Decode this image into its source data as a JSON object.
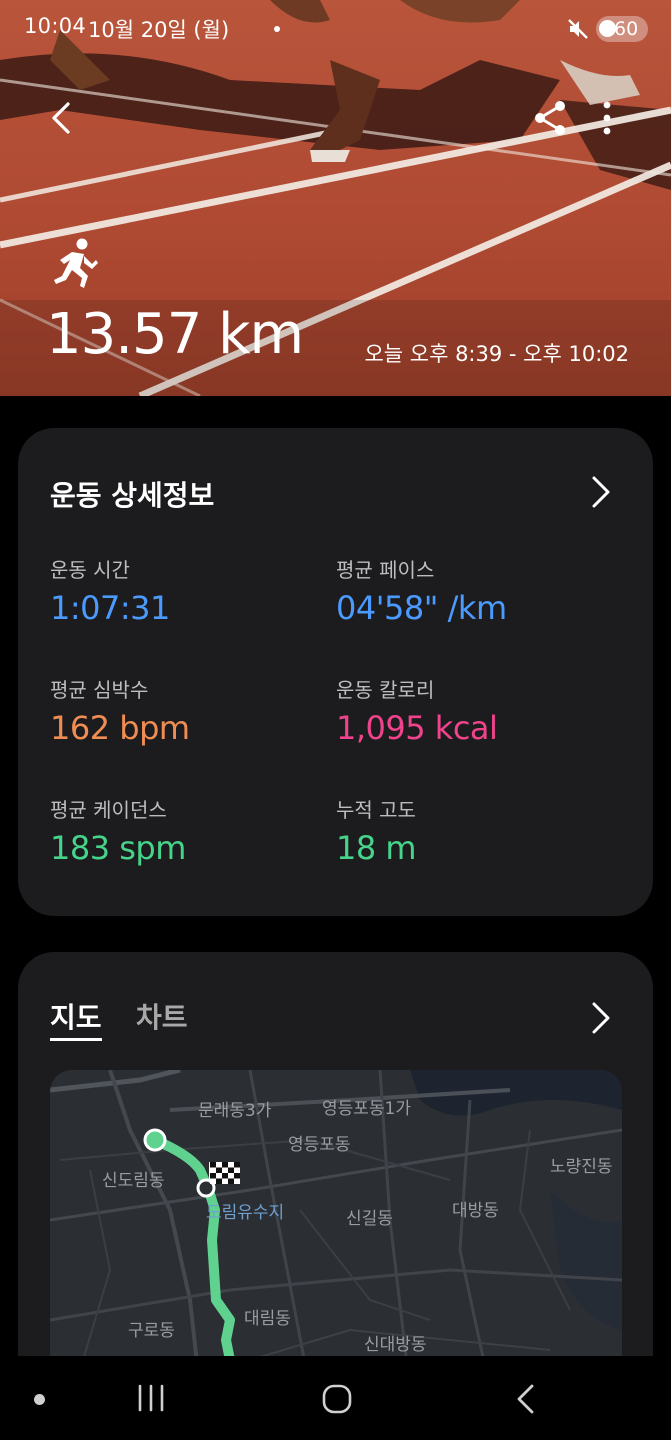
{
  "status_bar": {
    "time": "10:04",
    "date": "10월 20일 (월)",
    "battery": "60"
  },
  "header": {
    "distance": "13.57 km",
    "time_range": "오늘 오후 8:39 - 오후 10:02"
  },
  "details": {
    "title": "운동 상세정보",
    "metrics": [
      {
        "label": "운동 시간",
        "value": "1:07:31",
        "color": "#4b9bff"
      },
      {
        "label": "평균 페이스",
        "value": "04'58\" /km",
        "color": "#4b9bff"
      },
      {
        "label": "평균 심박수",
        "value": "162 bpm",
        "color": "#f08d52"
      },
      {
        "label": "운동 칼로리",
        "value": "1,095 kcal",
        "color": "#f0438c"
      },
      {
        "label": "평균 케이던스",
        "value": "183 spm",
        "color": "#46d48a"
      },
      {
        "label": "누적 고도",
        "value": "18 m",
        "color": "#46d48a"
      }
    ]
  },
  "map_section": {
    "tabs": [
      "지도",
      "차트"
    ],
    "active_tab": "지도",
    "route_color": "#5fd28f",
    "labels": [
      "문래동3가",
      "영등포동1가",
      "영등포동",
      "신도림동",
      "노량진동",
      "도림유수지",
      "신길동",
      "대방동",
      "구로동",
      "대림동",
      "신대방동"
    ]
  },
  "icons": {
    "back": "back-arrow-icon",
    "share": "share-icon",
    "more": "more-vertical-icon",
    "activity": "running-icon",
    "details_more": "chevron-right-icon",
    "map_more": "chevron-right-icon",
    "finish": "checkered-flag-icon",
    "nav_recent": "recent-apps-icon",
    "nav_home": "home-icon",
    "nav_back": "nav-back-icon"
  }
}
